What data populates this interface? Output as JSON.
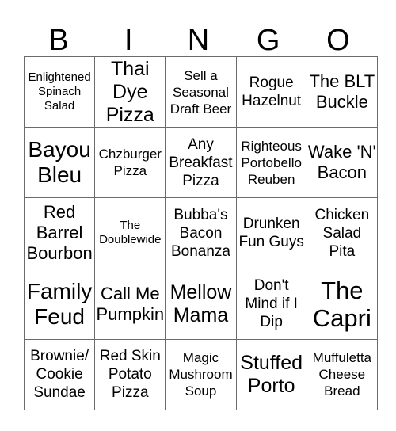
{
  "card": {
    "header_letters": [
      "B",
      "I",
      "N",
      "G",
      "O"
    ],
    "colors": {
      "background": "#ffffff",
      "text": "#000000",
      "grid_border": "#6b6b6b"
    },
    "rows": [
      [
        {
          "text": "Enlightened Spinach Salad",
          "size": "sz-s"
        },
        {
          "text": "Thai Dye Pizza",
          "size": "sz-xxl"
        },
        {
          "text": "Sell a Seasonal Draft Beer",
          "size": "sz-m"
        },
        {
          "text": "Rogue Hazelnut",
          "size": "sz-l"
        },
        {
          "text": "The BLT Buckle",
          "size": "sz-xl"
        }
      ],
      [
        {
          "text": "Bayou Bleu",
          "size": "sz-xxxl"
        },
        {
          "text": "Chzburger Pizza",
          "size": "sz-m"
        },
        {
          "text": "Any Breakfast Pizza",
          "size": "sz-l"
        },
        {
          "text": "Righteous Portobello Reuben",
          "size": "sz-m"
        },
        {
          "text": "Wake 'N' Bacon",
          "size": "sz-xl"
        }
      ],
      [
        {
          "text": "Red Barrel Bourbon",
          "size": "sz-xl"
        },
        {
          "text": "The Doublewide",
          "size": "sz-s"
        },
        {
          "text": "Bubba's Bacon Bonanza",
          "size": "sz-l"
        },
        {
          "text": "Drunken Fun Guys",
          "size": "sz-l"
        },
        {
          "text": "Chicken Salad Pita",
          "size": "sz-l"
        }
      ],
      [
        {
          "text": "Family Feud",
          "size": "sz-xxxl"
        },
        {
          "text": "Call Me Pumpkin",
          "size": "sz-xl"
        },
        {
          "text": "Mellow Mama",
          "size": "sz-xxl"
        },
        {
          "text": "Don't Mind if I Dip",
          "size": "sz-l"
        },
        {
          "text": "The Capri",
          "size": "sz-max"
        }
      ],
      [
        {
          "text": "Brownie/ Cookie Sundae",
          "size": "sz-l"
        },
        {
          "text": "Red Skin Potato Pizza",
          "size": "sz-l"
        },
        {
          "text": "Magic Mushroom Soup",
          "size": "sz-m"
        },
        {
          "text": "Stuffed Porto",
          "size": "sz-xxl"
        },
        {
          "text": "Muffuletta Cheese Bread",
          "size": "sz-m"
        }
      ]
    ]
  }
}
